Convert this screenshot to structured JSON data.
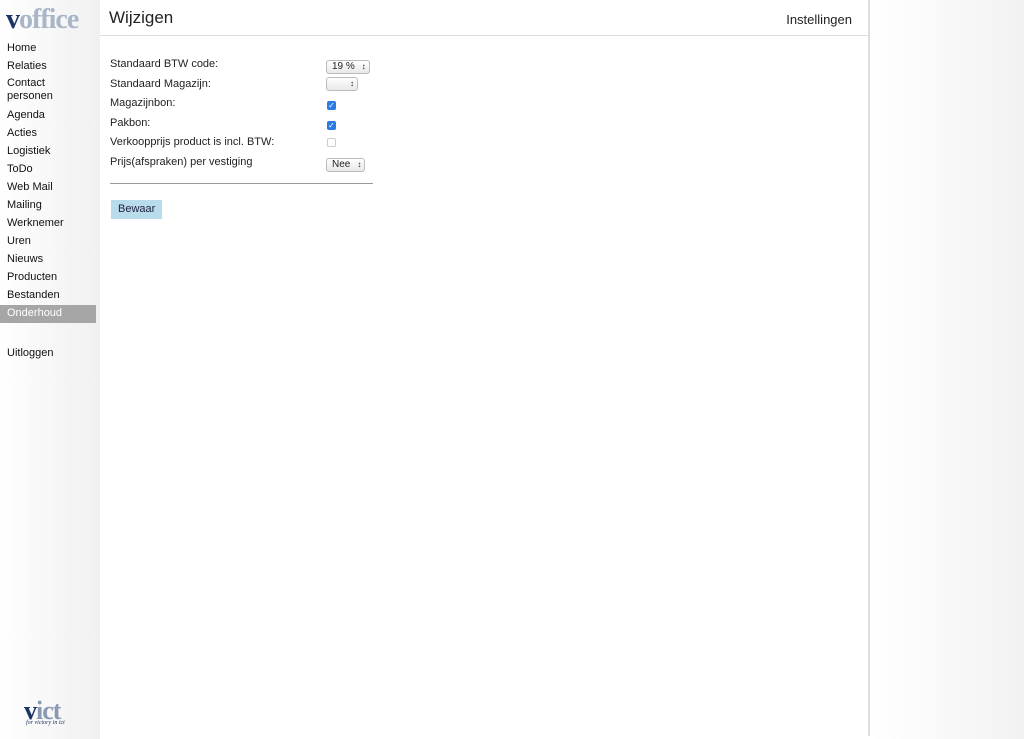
{
  "logo": {
    "text": "voffice",
    "v": "v",
    "rest": "office"
  },
  "sidebar": {
    "items": [
      {
        "label": "Home"
      },
      {
        "label": "Relaties"
      },
      {
        "label": "Contact personen"
      },
      {
        "label": "Agenda"
      },
      {
        "label": "Acties"
      },
      {
        "label": "Logistiek"
      },
      {
        "label": "ToDo"
      },
      {
        "label": "Web Mail"
      },
      {
        "label": "Mailing"
      },
      {
        "label": "Werknemer"
      },
      {
        "label": "Uren"
      },
      {
        "label": "Nieuws"
      },
      {
        "label": "Producten"
      },
      {
        "label": "Bestanden"
      },
      {
        "label": "Onderhoud",
        "active": true
      }
    ],
    "logout": "Uitloggen"
  },
  "footer_logo": {
    "text": "vict",
    "tagline": "for victory in ict"
  },
  "header": {
    "title": "Wijzigen",
    "settings": "Instellingen"
  },
  "form": {
    "btw_label": "Standaard BTW code:",
    "btw_value": "19 %",
    "magazijn_label": "Standaard Magazijn:",
    "magazijn_value": "",
    "magazijnbon_label": "Magazijnbon:",
    "magazijnbon_checked": true,
    "pakbon_label": "Pakbon:",
    "pakbon_checked": true,
    "incl_btw_label": "Verkoopprijs product is incl. BTW:",
    "incl_btw_checked": false,
    "vestiging_label": "Prijs(afspraken) per vestiging",
    "vestiging_value": "Nee",
    "save": "Bewaar"
  },
  "colors": {
    "accent": "#b8dcea",
    "active_nav": "#a6a6a6",
    "brand": "#1b3466",
    "checkbox": "#2a7be4"
  }
}
